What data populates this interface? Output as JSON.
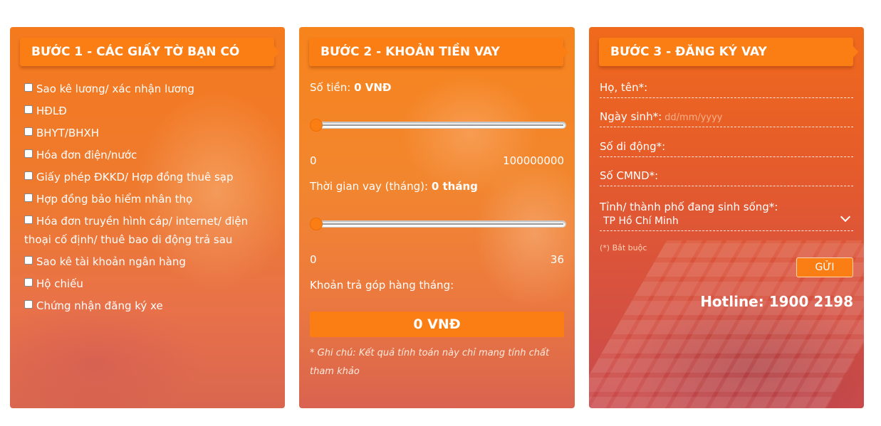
{
  "step1": {
    "title": "BƯỚC 1 - CÁC GIẤY TỜ BẠN CÓ",
    "documents": [
      "Sao kê lương/ xác nhận lương",
      "HĐLĐ",
      "BHYT/BHXH",
      "Hóa đơn điện/nước",
      "Giấy phép ĐKKD/ Hợp đồng thuê sạp",
      "Hợp đồng bảo hiểm nhân thọ",
      "Hóa đơn truyền hình cáp/ internet/ điện thoại cố định/ thuê bao di động trả sau",
      "Sao kê tài khoản ngân hàng",
      "Hộ chiếu",
      "Chứng nhận đăng ký xe"
    ]
  },
  "step2": {
    "title": "BƯỚC 2 - KHOẢN TIỀN VAY",
    "amount_label": "Số tiền:",
    "amount_value": "0 VNĐ",
    "amount_min": "0",
    "amount_max": "100000000",
    "amount_slider_fraction": 0,
    "term_label": "Thời gian vay (tháng):",
    "term_value": "0 tháng",
    "term_min": "0",
    "term_max": "36",
    "term_slider_fraction": 0,
    "installment_label": "Khoản trả góp hàng tháng:",
    "installment_value": "0 VNĐ",
    "note": "* Ghi chú: Kết quả tính toán này chỉ mang tính chất tham khảo"
  },
  "step3": {
    "title": "BƯỚC 3 - ĐĂNG KÝ VAY",
    "name_label": "Họ, tên*:",
    "dob_label": "Ngày sinh*:",
    "dob_placeholder": "dd/mm/yyyy",
    "phone_label": "Số di động*:",
    "id_label": "Số CMND*:",
    "province_label": "Tỉnh/ thành phố đang sinh sống*:",
    "province_value": "TP Hồ Chí Minh",
    "required_note": "(*) Bắt buộc",
    "submit_label": "GỬI",
    "hotline": "Hotline: 1900 2198"
  },
  "colors": {
    "accent": "#fb7e14",
    "text": "#ffffff"
  }
}
